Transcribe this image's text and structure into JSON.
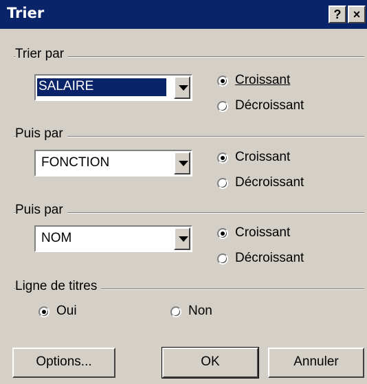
{
  "window": {
    "title": "Trier",
    "help_label": "?",
    "close_label": "×"
  },
  "sort1": {
    "label": "Trier par",
    "field": "SALAIRE",
    "ascending": "Croissant",
    "descending": "Décroissant",
    "selected": "ascending"
  },
  "sort2": {
    "label": "Puis par",
    "field": "FONCTION",
    "ascending": "Croissant",
    "descending": "Décroissant",
    "selected": "ascending"
  },
  "sort3": {
    "label": "Puis par",
    "field": "NOM",
    "ascending": "Croissant",
    "descending": "Décroissant",
    "selected": "ascending"
  },
  "header_row": {
    "label": "Ligne de titres",
    "yes": "Oui",
    "no": "Non",
    "selected": "yes"
  },
  "buttons": {
    "options": "Options...",
    "ok": "OK",
    "cancel": "Annuler"
  },
  "colors": {
    "titlebar": "#0a246a",
    "face": "#d4d0c8"
  }
}
